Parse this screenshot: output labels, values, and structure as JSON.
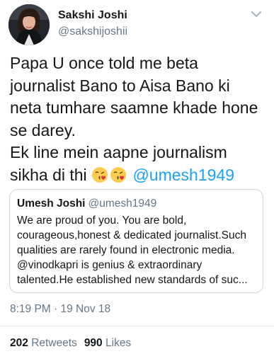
{
  "author": {
    "name": "Sakshi Joshi",
    "handle": "@sakshijoshii",
    "avatar": "avatar-photo"
  },
  "menu_icon": "chevron-down-icon",
  "tweet": {
    "text_lines": [
      "Papa U once told me beta",
      "journalist Bano to Aisa Bano ki",
      "neta tumhare saamne khade hone",
      "se darey.",
      "Ek line mein aapne journalism"
    ],
    "last_line_prefix": "sikha di thi",
    "emojis": [
      "face-blowing-kiss-emoji",
      "face-blowing-kiss-emoji"
    ],
    "mention": "@umesh1949"
  },
  "quoted_tweet": {
    "name": "Umesh Joshi",
    "handle": "@umesh1949",
    "lines": [
      "We are proud of you. You are bold,",
      "courageous,honest & dedicated journalist.Such",
      "qualities are rarely found in electronic media.",
      "@vinodkapri is genius & extraordinary",
      "talented.He established new standards of suc..."
    ]
  },
  "timestamp": "8:19 PM · 19 Nov 18",
  "stats": {
    "retweets_count": "202",
    "retweets_label": "Retweets",
    "likes_count": "990",
    "likes_label": "Likes"
  },
  "colors": {
    "link": "#1da1f2",
    "secondary_text": "#657786",
    "border": "#ccd6dd"
  }
}
